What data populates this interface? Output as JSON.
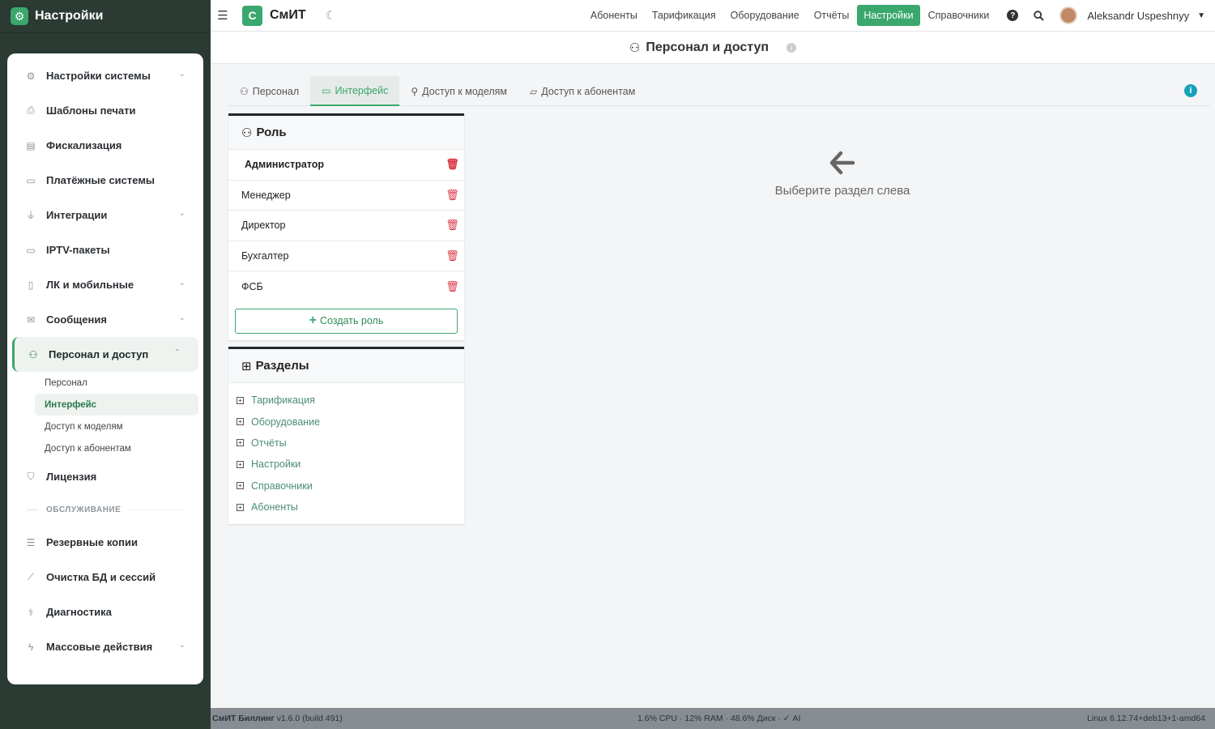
{
  "sidebar": {
    "title": "Настройки",
    "items": [
      {
        "label": "Настройки системы",
        "icon": "gears-icon"
      },
      {
        "label": "Шаблоны печати",
        "icon": "print-icon"
      },
      {
        "label": "Фискализация",
        "icon": "cash-register-icon"
      },
      {
        "label": "Платёжные системы",
        "icon": "credit-card-icon"
      },
      {
        "label": "Интеграции",
        "icon": "plug-icon"
      },
      {
        "label": "IPTV-пакеты",
        "icon": "tv-icon"
      },
      {
        "label": "ЛК и мобильные",
        "icon": "mobile-icon"
      },
      {
        "label": "Сообщения",
        "icon": "envelope-icon"
      },
      {
        "label": "Персонал и доступ",
        "icon": "users-cog-icon"
      },
      {
        "label": "Лицензия",
        "icon": "shield-icon"
      },
      {
        "label": "Резервные копии",
        "icon": "database-icon"
      },
      {
        "label": "Очистка БД и сессий",
        "icon": "broom-icon"
      },
      {
        "label": "Диагностика",
        "icon": "stethoscope-icon"
      },
      {
        "label": "Массовые действия",
        "icon": "bolt-icon"
      }
    ],
    "subitems": [
      "Персонал",
      "Интерфейс",
      "Доступ к моделям",
      "Доступ к абонентам"
    ],
    "section_label": "ОБСЛУЖИВАНИЕ"
  },
  "topbar": {
    "brand_letter": "С",
    "brand_name": "СмИТ",
    "nav": [
      "Абоненты",
      "Тарификация",
      "Оборудование",
      "Отчёты",
      "Настройки",
      "Справочники"
    ],
    "active_nav": "Настройки",
    "user_name": "Aleksandr Uspeshnyy"
  },
  "page": {
    "title": "Персонал и доступ"
  },
  "tabs": [
    "Персонал",
    "Интерфейс",
    "Доступ к моделям",
    "Доступ к абонентам"
  ],
  "roles_card": {
    "title": "Роль",
    "roles": [
      "Администратор",
      "Менеджер",
      "Директор",
      "Бухгалтер",
      "ФСБ"
    ],
    "create_label": "Создать роль"
  },
  "sections_card": {
    "title": "Разделы",
    "items": [
      "Тарификация",
      "Оборудование",
      "Отчёты",
      "Настройки",
      "Справочники",
      "Абоненты"
    ]
  },
  "empty_state": {
    "text": "Выберите раздел слева"
  },
  "footer": {
    "app_name": "СмИТ Биллинг",
    "version": "v1.6.0 (build 491)",
    "stats": "1.6% CPU · 12% RAM · 48.6% Диск · ✓ AI",
    "os": "Linux 6.12.74+deb13+1-amd64"
  },
  "colors": {
    "accent": "#3aa76d",
    "sidebar_bg": "#2b3a32",
    "danger": "#dc3545",
    "info": "#17a2b8",
    "footer_bg": "#878d93"
  }
}
